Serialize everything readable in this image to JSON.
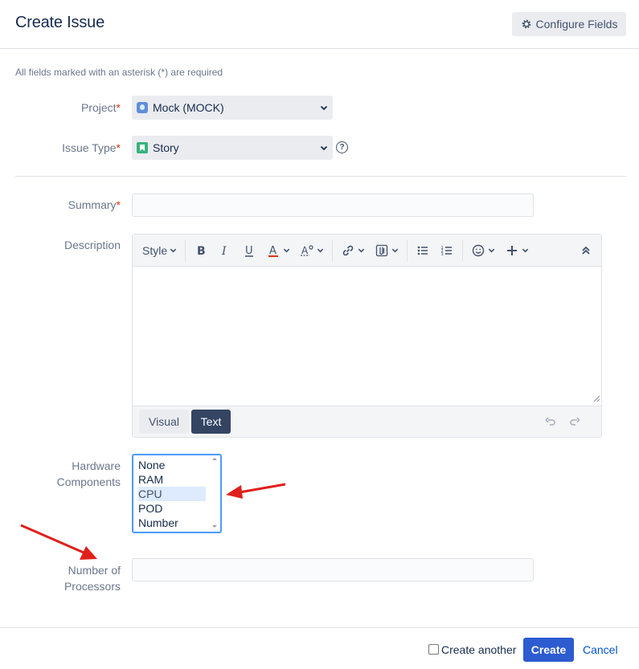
{
  "dialog": {
    "title": "Create Issue",
    "configure_fields_label": "Configure Fields",
    "required_note": "All fields marked with an asterisk (*) are required"
  },
  "fields": {
    "project": {
      "label": "Project",
      "required_mark": "*",
      "value": "Mock (MOCK)"
    },
    "issue_type": {
      "label": "Issue Type",
      "required_mark": "*",
      "value": "Story"
    },
    "summary": {
      "label": "Summary",
      "required_mark": "*",
      "value": ""
    },
    "description": {
      "label": "Description",
      "toolbar": {
        "style_label": "Style"
      },
      "modes": {
        "visual": "Visual",
        "text": "Text",
        "active": "Text"
      }
    },
    "hardware_components": {
      "label_line1": "Hardware",
      "label_line2": "Components",
      "options": [
        "None",
        "RAM",
        "CPU",
        "POD Number"
      ],
      "selected": "CPU"
    },
    "number_of_processors": {
      "label_line1": "Number of",
      "label_line2": "Processors",
      "value": ""
    }
  },
  "footer": {
    "create_another_label": "Create another",
    "create_another_checked": false,
    "create_label": "Create",
    "cancel_label": "Cancel"
  },
  "colors": {
    "primary": "#2d5bd0",
    "required": "#de350b",
    "link": "#0052cc",
    "focus": "#4c9aff",
    "annotation_arrow": "#e0201b"
  },
  "icons": [
    "gear-icon",
    "project-avatar-icon",
    "story-icon",
    "chevron-down-icon",
    "help-icon",
    "bold-icon",
    "italic-icon",
    "underline-icon",
    "text-color-icon",
    "text-effects-icon",
    "link-icon",
    "attachment-icon",
    "bullet-list-icon",
    "numbered-list-icon",
    "emoji-icon",
    "insert-more-icon",
    "collapse-toolbar-icon",
    "undo-icon",
    "redo-icon"
  ]
}
